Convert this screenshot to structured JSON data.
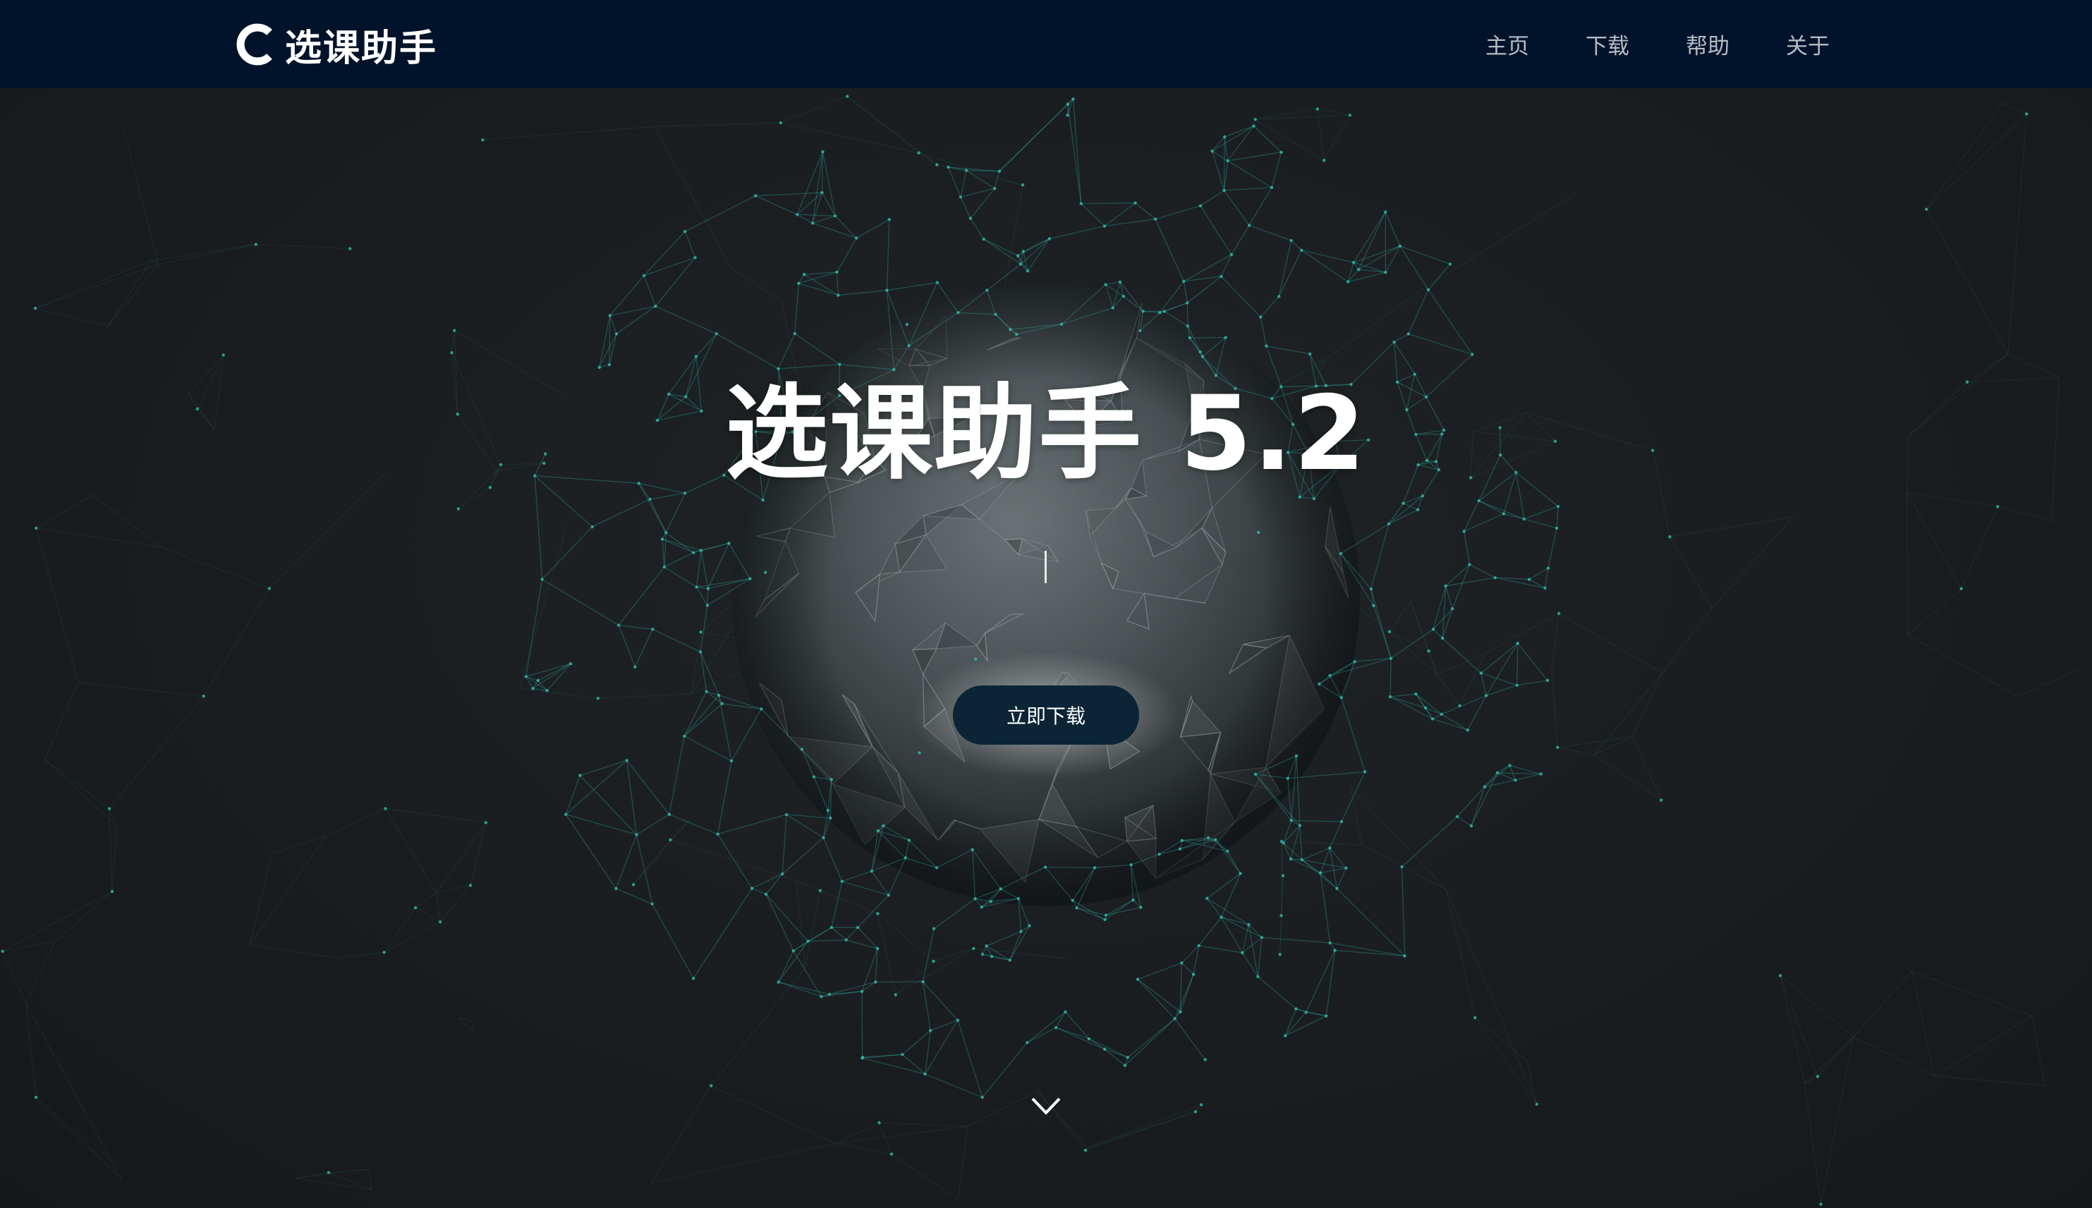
{
  "app": {
    "brand_name": "选课助手",
    "logo_icon": "c-logo-icon"
  },
  "nav": {
    "items": [
      {
        "label": "主页"
      },
      {
        "label": "下载"
      },
      {
        "label": "帮助"
      },
      {
        "label": "关于"
      }
    ]
  },
  "hero": {
    "title": "选课助手 5.2",
    "download_label": "立即下载",
    "scroll_icon": "chevron-down-icon"
  },
  "colors": {
    "navbar_bg": "#01132a",
    "page_bg": "#1a1d1f",
    "mesh_line": "#2f8f8a",
    "mesh_dot": "#35c4b4",
    "button_bg": "#0b2436",
    "nav_text": "#b6bcc4"
  }
}
